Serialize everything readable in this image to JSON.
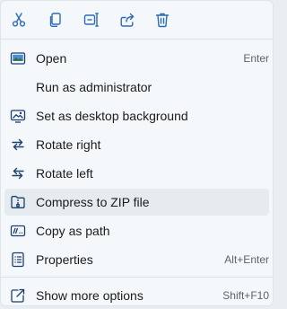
{
  "colors": {
    "accent": "#2b6cb8",
    "menu_background": "#f5f8fb",
    "hover_background": "#e6ebf0",
    "text": "#1b1b1b",
    "shortcut_text": "#5f6368"
  },
  "toolbar": {
    "buttons": [
      {
        "icon": "cut-icon"
      },
      {
        "icon": "copy-icon"
      },
      {
        "icon": "rename-icon"
      },
      {
        "icon": "share-icon"
      },
      {
        "icon": "delete-icon"
      }
    ]
  },
  "menu": {
    "items": [
      {
        "label": "Open",
        "shortcut": "Enter",
        "icon": "open-icon"
      },
      {
        "label": "Run as administrator",
        "shortcut": "",
        "icon": ""
      },
      {
        "label": "Set as desktop background",
        "shortcut": "",
        "icon": "desktop-background-icon"
      },
      {
        "label": "Rotate right",
        "shortcut": "",
        "icon": "rotate-right-icon"
      },
      {
        "label": "Rotate left",
        "shortcut": "",
        "icon": "rotate-left-icon"
      },
      {
        "label": "Compress to ZIP file",
        "shortcut": "",
        "icon": "zip-icon"
      },
      {
        "label": "Copy as path",
        "shortcut": "",
        "icon": "copy-path-icon"
      },
      {
        "label": "Properties",
        "shortcut": "Alt+Enter",
        "icon": "properties-icon"
      },
      {
        "label": "Show more options",
        "shortcut": "Shift+F10",
        "icon": "more-options-icon"
      }
    ]
  }
}
